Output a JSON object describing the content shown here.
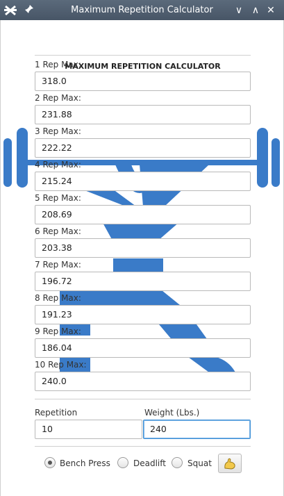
{
  "window": {
    "title": "Maximum Repetition Calculator",
    "controls": {
      "minimize": "∨",
      "maximize": "∧",
      "close": "✕"
    }
  },
  "app": {
    "heading": "MAXIMUM REPETITION CALCULATOR"
  },
  "reps": [
    {
      "label": "1 Rep Max:",
      "value": "318.0"
    },
    {
      "label": "2 Rep Max:",
      "value": "231.88"
    },
    {
      "label": "3 Rep Max:",
      "value": "222.22"
    },
    {
      "label": "4 Rep Max:",
      "value": "215.24"
    },
    {
      "label": "5 Rep Max:",
      "value": "208.69"
    },
    {
      "label": "6 Rep Max:",
      "value": "203.38"
    },
    {
      "label": "7 Rep Max:",
      "value": "196.72"
    },
    {
      "label": "8 Rep Max:",
      "value": "191.23"
    },
    {
      "label": "9 Rep Max:",
      "value": "186.04"
    },
    {
      "label": "10 Rep Max:",
      "value": "240.0"
    }
  ],
  "inputs": {
    "repetition_label": "Repetition",
    "repetition_value": "10",
    "weight_label": "Weight (Lbs.)",
    "weight_value": "240"
  },
  "exercises": [
    {
      "label": "Bench Press",
      "selected": true
    },
    {
      "label": "Deadlift",
      "selected": false
    },
    {
      "label": "Squat",
      "selected": false
    }
  ],
  "colors": {
    "accent": "#3a7bc8",
    "titlebar": "#4f5d6e"
  },
  "icons": {
    "app": "barbell-x-icon",
    "pin": "pin-icon",
    "flex": "flexed-arm-icon"
  }
}
